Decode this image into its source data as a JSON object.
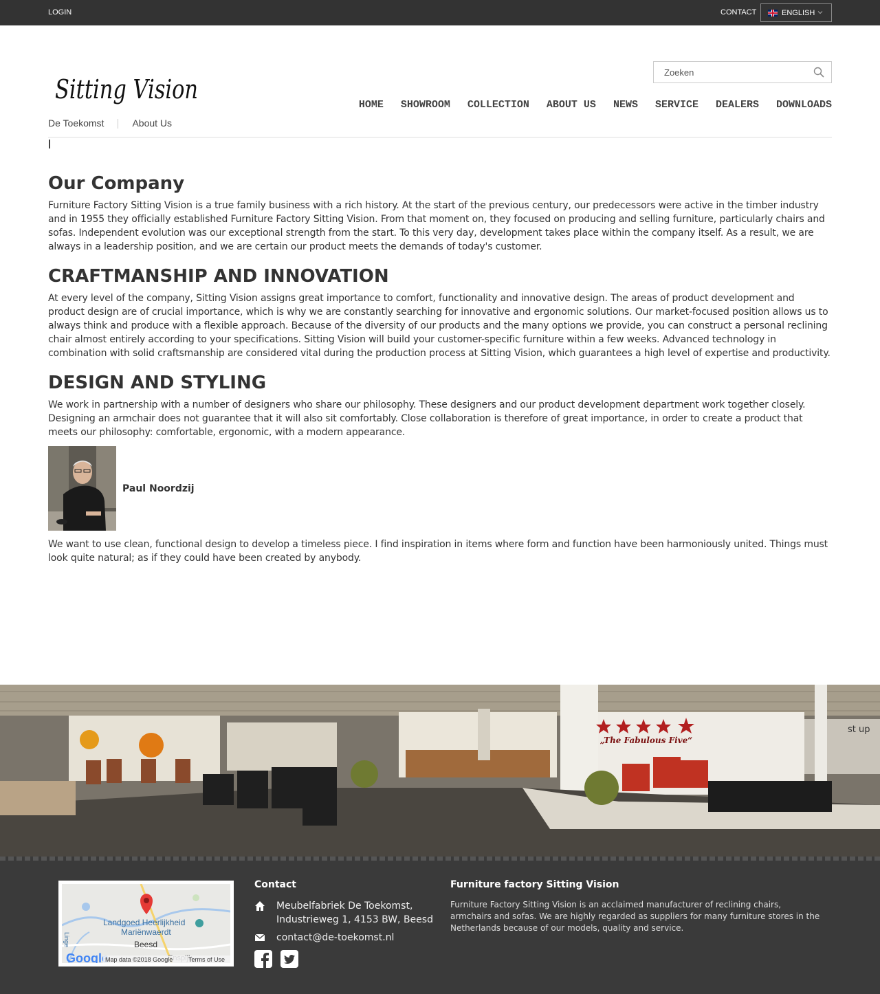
{
  "topbar": {
    "login": "LOGIN",
    "contact": "CONTACT",
    "language": "ENGLISH"
  },
  "header": {
    "logo_text": "Sitting Vision",
    "search_placeholder": "Zoeken",
    "nav": [
      "HOME",
      "SHOWROOM",
      "COLLECTION",
      "ABOUT US",
      "NEWS",
      "SERVICE",
      "DEALERS",
      "DOWNLOADS"
    ]
  },
  "breadcrumb": [
    "De Toekomst",
    "About Us"
  ],
  "content": {
    "title": "Our Company",
    "intro": "Furniture Factory Sitting Vision is a true family business with a rich history. At the start of the previous century, our predecessors were active in the timber industry and in 1955 they officially established Furniture Factory Sitting Vision. From that moment on, they focused on producing and selling furniture, particularly chairs and sofas. Independent evolution was our exceptional strength from the start. To this very day, development takes place within the company itself. As a result, we are always in a leadership position, and we are certain our product meets the demands of today's customer.",
    "section1_title": "CRAFTMANSHIP AND INNOVATION",
    "section1_text": "At every level of the company, Sitting Vision assigns great importance to comfort, functionality and innovative design. The areas of product development and product design are of crucial importance, which is why we are constantly searching for innovative and ergonomic solutions. Our market-focused position allows us to always think and produce with a flexible approach. Because of the diversity of our products and the many options we provide, you can construct a personal reclining chair almost entirely according to your specifications. Sitting Vision will build your customer-specific furniture within a few weeks. Advanced technology in combination with solid craftsmanship are considered vital during the production process at Sitting Vision, which guarantees a high level of expertise and productivity.",
    "section2_title": "DESIGN AND STYLING",
    "section2_text": "We work in partnership with a number of designers who share our philosophy. These designers and our product development department work together closely. Designing an armchair does not guarantee that it will also sit comfortably. Close collaboration is therefore of great importance, in order to create a product that meets our philosophy: comfortable, ergonomic, with a modern appearance.",
    "designer_name": "Paul Noordzij",
    "quote": "We want to use clean, functional design to develop a timeless piece. I find inspiration in items where form and function have been harmoniously united. Things must look quite natural; as if they could have been created by anybody."
  },
  "banner": {
    "sign_text": "„The Fabulous Five“",
    "sign_fragment": "st up"
  },
  "footer": {
    "map": {
      "place1": "Landgoed Heerlijkheid",
      "place2": "Mariënwaerdt",
      "place3": "Beesd",
      "place4": "Enspijk",
      "place5": "Linge",
      "logo": "Google",
      "attribution": "Map data ©2018 Google",
      "terms": "Terms of Use"
    },
    "contact_title": "Contact",
    "address": "Meubelfabriek De Toekomst, Industrieweg 1, 4153 BW, Beesd",
    "email": "contact@de-toekomst.nl",
    "about_title": "Furniture factory Sitting Vision",
    "about_text": "Furniture Factory Sitting Vision is an acclaimed manufacturer of reclining chairs, armchairs and sofas. We are highly regarded as suppliers for many furniture stores in the Netherlands because of our models, quality and service."
  }
}
